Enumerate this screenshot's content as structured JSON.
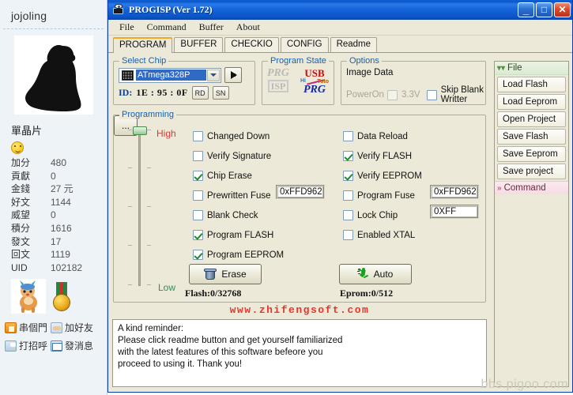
{
  "forum": {
    "username": "jojoling",
    "avatar_alt": "user-avatar-silhouette",
    "signature": "單晶片",
    "stats": [
      {
        "label": "加分",
        "value": "480"
      },
      {
        "label": "貢獻",
        "value": "0"
      },
      {
        "label": "金錢",
        "value": "27 元"
      },
      {
        "label": "好文",
        "value": "1144"
      },
      {
        "label": "威望",
        "value": "0"
      },
      {
        "label": "積分",
        "value": "1616"
      },
      {
        "label": "發文",
        "value": "17"
      },
      {
        "label": "回文",
        "value": "1119"
      },
      {
        "label": "UID",
        "value": "102182"
      }
    ],
    "links": [
      {
        "label": "串個門",
        "icon": "home-icon"
      },
      {
        "label": "加好友",
        "icon": "handshake-icon"
      },
      {
        "label": "打招呼",
        "icon": "greet-icon"
      },
      {
        "label": "發消息",
        "icon": "mail-icon"
      }
    ]
  },
  "window": {
    "title": "PROGISP (Ver 1.72)",
    "icon": "chip-eye-icon",
    "buttons": {
      "minimize": "_",
      "maximize": "□",
      "close": "✕"
    },
    "menu": [
      "File",
      "Command",
      "Buffer",
      "About"
    ],
    "tabs": [
      {
        "label": "PROGRAM",
        "active": true
      },
      {
        "label": "BUFFER",
        "active": false
      },
      {
        "label": "CHECKIO",
        "active": false
      },
      {
        "label": "CONFIG",
        "active": false
      },
      {
        "label": "Readme",
        "active": false
      }
    ]
  },
  "select_chip": {
    "legend": "Select Chip",
    "chip_value": "ATmega328P",
    "go_button": "go-arrow",
    "id_label": "ID:",
    "id_value": "1E : 95 : 0F",
    "rd_button": "RD",
    "sn_button": "SN"
  },
  "program_state": {
    "legend": "Program State",
    "prg_isp_top": "PRG",
    "prg_isp_bottom": "ISP",
    "usb_top": "USB",
    "usb_mid_left": "Hi",
    "usb_mid_right": "Toto",
    "usb_bottom": "PRG"
  },
  "options": {
    "legend": "Options",
    "image_data": "Image Data",
    "power_on": "PowerOn",
    "volt_label": "3.3V",
    "volt_checked": false,
    "skip_blank": "Skip Blank Writter",
    "skip_blank_checked": false
  },
  "programming": {
    "legend": "Programming",
    "slider_high": "High",
    "slider_low": "Low",
    "col_left": [
      {
        "label": "Changed Down",
        "checked": false
      },
      {
        "label": "Verify Signature",
        "checked": false
      },
      {
        "label": "Chip Erase",
        "checked": true
      },
      {
        "label": "Prewritten Fuse",
        "checked": false
      },
      {
        "label": "Blank Check",
        "checked": false
      },
      {
        "label": "Program FLASH",
        "checked": true
      },
      {
        "label": "Program EEPROM",
        "checked": true
      }
    ],
    "col_right": [
      {
        "label": "Data Reload",
        "checked": false
      },
      {
        "label": "Verify FLASH",
        "checked": true
      },
      {
        "label": "Verify EEPROM",
        "checked": true
      },
      {
        "label": "Program Fuse",
        "checked": false
      },
      {
        "label": "Lock Chip",
        "checked": false
      },
      {
        "label": "Enabled XTAL",
        "checked": false
      }
    ],
    "prewritten_fuse_value": "0xFFD962",
    "program_fuse_value": "0xFFD962",
    "lock_chip_value": "0XFF",
    "erase_button": "Erase",
    "auto_button": "Auto",
    "more_button": "...",
    "flash_count": "Flash:0/32768",
    "eprom_count": "Eprom:0/512"
  },
  "brand": "www.zhifengsoft.com",
  "reminder": {
    "line1": "A kind reminder:",
    "line2": "Please click readme button and get yourself familiarized",
    "line3": "with the latest features of this software befeore you",
    "line4": "proceed to using it. Thank you!"
  },
  "dock": {
    "file_header": "File",
    "file_buttons": [
      "Load Flash",
      "Load Eeprom",
      "Open Project",
      "Save Flash",
      "Save Eeprom",
      "Save project"
    ],
    "command_header": "Command"
  },
  "watermark": "bbs.pigoo.com",
  "colors": {
    "titlebar": "#1464da",
    "panel": "#ece9d8",
    "accent_tab": "#f5a623",
    "legend_text": "#1b5fa8",
    "brand_red": "#e8342a",
    "high_red": "#d23b3b",
    "low_green": "#3b8a5a",
    "check_green": "#1f8a2f",
    "selection_blue": "#316ac5"
  }
}
